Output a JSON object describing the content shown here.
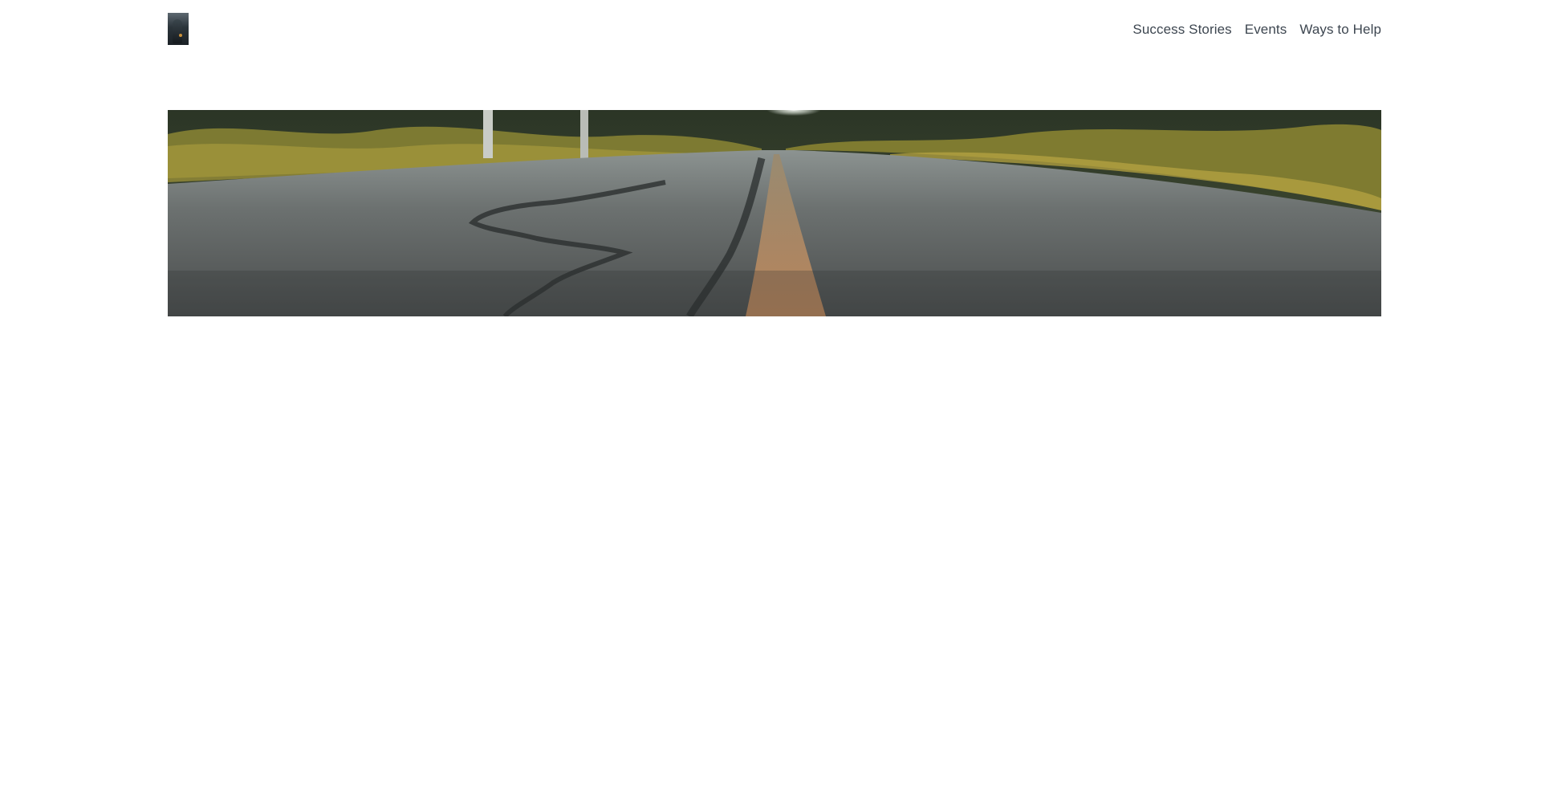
{
  "nav": {
    "items": [
      {
        "label": "Success Stories"
      },
      {
        "label": "Events"
      },
      {
        "label": "Ways to Help"
      }
    ]
  },
  "hero": {
    "subject": "empty asphalt road through forest",
    "colors": {
      "asphalt": "#5b5f5f",
      "foliage": "#8a8a3a",
      "centerline": "#b8865a",
      "sky": "#e9ece8"
    }
  },
  "colors": {
    "nav_text": "#3d4650",
    "background": "#ffffff"
  }
}
